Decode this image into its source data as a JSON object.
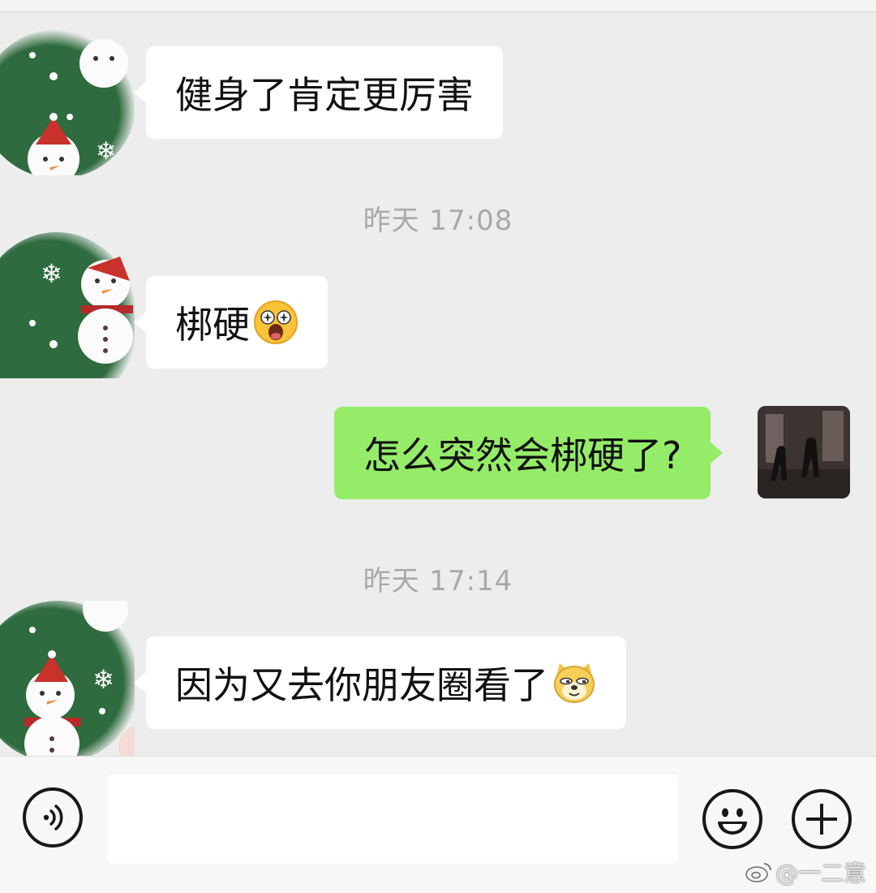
{
  "messages": [
    {
      "side": "left",
      "text": "健身了肯定更厉害",
      "emoji": ""
    },
    {
      "side": "left",
      "text": "梆硬",
      "emoji": "star-struck-emoji"
    },
    {
      "side": "right",
      "text": "怎么突然会梆硬了?",
      "emoji": ""
    },
    {
      "side": "left",
      "text": "因为又去你朋友圈看了",
      "emoji": "doge-emoji"
    }
  ],
  "timestamps": [
    "昨天 17:08",
    "昨天 17:14"
  ],
  "input_bar": {
    "voice_icon": "voice-icon",
    "emoji_icon": "smiley-icon",
    "plus_icon": "plus-icon",
    "text_value": ""
  },
  "watermark": "@一二意",
  "colors": {
    "background": "#ededed",
    "bubble_self": "#95ec69",
    "bubble_other": "#ffffff",
    "avatar_green": "#2e6b3e"
  }
}
